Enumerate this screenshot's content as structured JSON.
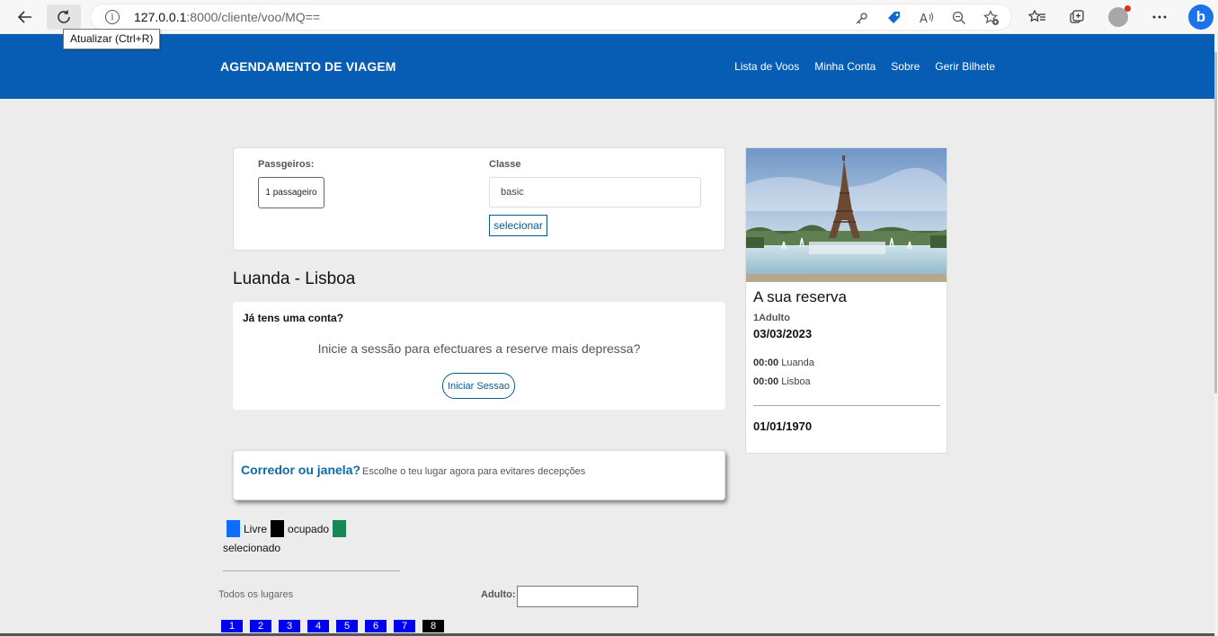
{
  "browser": {
    "url_host": "127.0.0.1",
    "url_rest": ":8000/cliente/voo/MQ==",
    "tooltip": "Atualizar (Ctrl+R)",
    "icons": [
      "back-icon",
      "refresh-icon",
      "info-icon",
      "key-icon",
      "coupon-icon",
      "read-aloud-icon",
      "zoom-out-icon",
      "add-favorite-icon",
      "favorites-icon",
      "collections-icon",
      "profile-icon",
      "more-icon",
      "bing-icon"
    ],
    "bing_label": "b"
  },
  "nav": {
    "brand": "AGENDAMENTO DE VIAGEM",
    "links": [
      "Lista de Voos",
      "Minha Conta",
      "Sobre",
      "Gerir Bilhete"
    ]
  },
  "form": {
    "passengers_label": "Passgeiros:",
    "passengers_value": "1 passageiro",
    "class_label": "Classe",
    "class_value": "basic",
    "select_label": "selecionar"
  },
  "route": "Luanda - Lisboa",
  "login": {
    "question": "Já tens uma conta?",
    "message": "Inicie a sessão para efectuares a reserve mais depressa?",
    "button": "Iniciar Sessao"
  },
  "seat_choice": {
    "title": "Corredor ou janela?",
    "subtitle": "Escolhe o teu lugar agora para evitares decepções"
  },
  "legend": {
    "free": "Livre",
    "occupied": "ocupado",
    "selected": "selecionado",
    "colors": {
      "free": "#0d6efd",
      "occupied": "#000000",
      "selected": "#198754"
    }
  },
  "seats_section": {
    "all_label": "Todos os lugares",
    "adult_label": "Adulto:",
    "seats": [
      {
        "label": "1",
        "status": "free"
      },
      {
        "label": "2",
        "status": "free"
      },
      {
        "label": "3",
        "status": "free"
      },
      {
        "label": "4",
        "status": "free"
      },
      {
        "label": "5",
        "status": "free"
      },
      {
        "label": "6",
        "status": "free"
      },
      {
        "label": "7",
        "status": "free"
      },
      {
        "label": "8",
        "status": "occupied"
      }
    ],
    "seat_colors": {
      "free": "#0000ee",
      "occupied": "#000000"
    }
  },
  "reservation": {
    "title": "A sua reserva",
    "passengers": "1Adulto",
    "date": "03/03/2023",
    "departure_time": "00:00",
    "departure_city": "Luanda",
    "arrival_time": "00:00",
    "arrival_city": "Lisboa",
    "return_date": "01/01/1970"
  },
  "colors": {
    "nav": "#065db3",
    "accent": "#0b5a8e",
    "page_bg": "#ececec"
  }
}
